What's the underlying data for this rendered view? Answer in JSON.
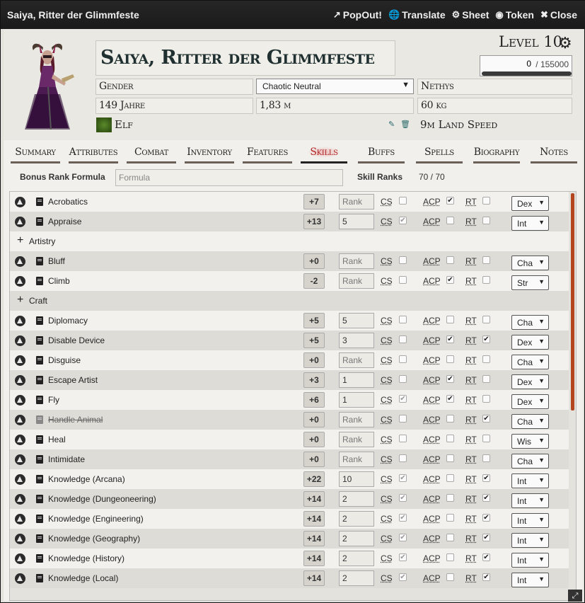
{
  "window": {
    "title": "Saiya, Ritter der Glimmfeste",
    "actions": [
      {
        "icon": "popout-icon",
        "label": "PopOut!"
      },
      {
        "icon": "globe-icon",
        "label": "Translate"
      },
      {
        "icon": "gear-icon",
        "label": "Sheet"
      },
      {
        "icon": "user-circle-icon",
        "label": "Token"
      },
      {
        "icon": "close-icon",
        "label": "Close"
      }
    ]
  },
  "header": {
    "name": "Saiya, Ritter der Glimmfeste",
    "gender": "Gender",
    "alignment": "Chaotic Neutral",
    "deity": "Nethys",
    "age": "149 Jahre",
    "height": "1,83 m",
    "weight": "60 kg",
    "race": "Elf",
    "speed": "9m Land Speed",
    "level": "Level 10",
    "xp_current": "0",
    "xp_max": "/ 155000",
    "xp_progress": 0
  },
  "tabs": [
    "Summary",
    "Attributes",
    "Combat",
    "Inventory",
    "Features",
    "Skills",
    "Buffs",
    "Spells",
    "Biography",
    "Notes"
  ],
  "active_tab": "Skills",
  "skill_config": {
    "bonus_label": "Bonus Rank Formula",
    "formula_placeholder": "Formula",
    "ranks_label": "Skill Ranks",
    "ranks_value": "70 / 70"
  },
  "labels": {
    "cs": "CS",
    "acp": "ACP",
    "rt": "RT"
  },
  "skills": [
    {
      "kind": "skill",
      "name": "Acrobatics",
      "mod": "+7",
      "rank": "Rank",
      "cs": false,
      "acp": true,
      "rt": false,
      "ability": "Dex"
    },
    {
      "kind": "skill",
      "name": "Appraise",
      "mod": "+13",
      "rank": "5",
      "cs": true,
      "acp": false,
      "rt": false,
      "ability": "Int"
    },
    {
      "kind": "group",
      "name": "Artistry"
    },
    {
      "kind": "skill",
      "name": "Bluff",
      "mod": "+0",
      "rank": "Rank",
      "cs": false,
      "acp": false,
      "rt": false,
      "ability": "Cha"
    },
    {
      "kind": "skill",
      "name": "Climb",
      "mod": "-2",
      "rank": "Rank",
      "cs": false,
      "acp": true,
      "rt": false,
      "ability": "Str"
    },
    {
      "kind": "group",
      "name": "Craft"
    },
    {
      "kind": "skill",
      "name": "Diplomacy",
      "mod": "+5",
      "rank": "5",
      "cs": false,
      "acp": false,
      "rt": false,
      "ability": "Cha"
    },
    {
      "kind": "skill",
      "name": "Disable Device",
      "mod": "+5",
      "rank": "3",
      "cs": false,
      "acp": true,
      "rt": true,
      "ability": "Dex"
    },
    {
      "kind": "skill",
      "name": "Disguise",
      "mod": "+0",
      "rank": "Rank",
      "cs": false,
      "acp": false,
      "rt": false,
      "ability": "Cha"
    },
    {
      "kind": "skill",
      "name": "Escape Artist",
      "mod": "+3",
      "rank": "1",
      "cs": false,
      "acp": true,
      "rt": false,
      "ability": "Dex"
    },
    {
      "kind": "skill",
      "name": "Fly",
      "mod": "+6",
      "rank": "1",
      "cs": true,
      "acp": true,
      "rt": false,
      "ability": "Dex"
    },
    {
      "kind": "skill",
      "name": "Handle Animal",
      "mod": "+0",
      "rank": "Rank",
      "cs": false,
      "acp": false,
      "rt": true,
      "ability": "Cha",
      "strike": true
    },
    {
      "kind": "skill",
      "name": "Heal",
      "mod": "+0",
      "rank": "Rank",
      "cs": false,
      "acp": false,
      "rt": false,
      "ability": "Wis"
    },
    {
      "kind": "skill",
      "name": "Intimidate",
      "mod": "+0",
      "rank": "Rank",
      "cs": false,
      "acp": false,
      "rt": false,
      "ability": "Cha"
    },
    {
      "kind": "skill",
      "name": "Knowledge (Arcana)",
      "mod": "+22",
      "rank": "10",
      "cs": true,
      "acp": false,
      "rt": true,
      "ability": "Int"
    },
    {
      "kind": "skill",
      "name": "Knowledge (Dungeoneering)",
      "mod": "+14",
      "rank": "2",
      "cs": true,
      "acp": false,
      "rt": true,
      "ability": "Int"
    },
    {
      "kind": "skill",
      "name": "Knowledge (Engineering)",
      "mod": "+14",
      "rank": "2",
      "cs": true,
      "acp": false,
      "rt": true,
      "ability": "Int"
    },
    {
      "kind": "skill",
      "name": "Knowledge (Geography)",
      "mod": "+14",
      "rank": "2",
      "cs": true,
      "acp": false,
      "rt": true,
      "ability": "Int"
    },
    {
      "kind": "skill",
      "name": "Knowledge (History)",
      "mod": "+14",
      "rank": "2",
      "cs": true,
      "acp": false,
      "rt": true,
      "ability": "Int"
    },
    {
      "kind": "skill",
      "name": "Knowledge (Local)",
      "mod": "+14",
      "rank": "2",
      "cs": true,
      "acp": false,
      "rt": true,
      "ability": "Int"
    }
  ]
}
